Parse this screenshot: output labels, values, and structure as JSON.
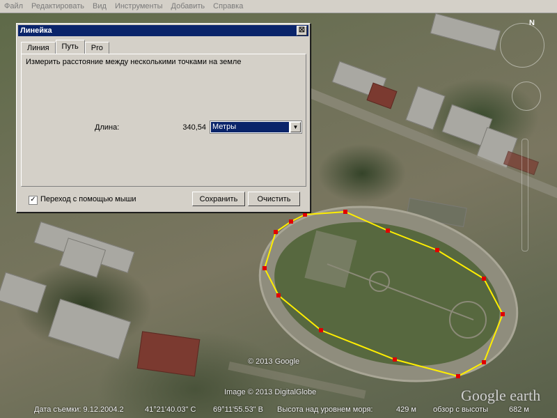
{
  "menubar": {
    "items": [
      "Файл",
      "Редактировать",
      "Вид",
      "Инструменты",
      "Добавить",
      "Справка"
    ]
  },
  "dialog": {
    "title": "Линейка",
    "close_label": "☒",
    "tabs": [
      "Линия",
      "Путь",
      "Pro"
    ],
    "active_tab": "Путь",
    "description": "Измерить расстояние между несколькими точками на земле",
    "length_label": "Длина:",
    "length_value": "340,54",
    "units_selected": "Метры",
    "mouse_nav_label": "Переход с помощью мыши",
    "mouse_nav_checked": true,
    "save_label": "Сохранить",
    "clear_label": "Очистить"
  },
  "map": {
    "compass_label": "N",
    "copyright_google": "© 2013 Google",
    "copyright_imagery": "Image © 2013 DigitalGlobe",
    "logo": "Google earth",
    "path_color": "#ffee00",
    "vertex_color": "#e00000"
  },
  "statusbar": {
    "imagery_date": "Дата съемки: 9.12.2004.2",
    "latitude": "41°21'40.03\" С",
    "longitude": "69°11'55.53\" В",
    "elevation_label": "Высота над уровнем моря:",
    "elevation_value": "429 м",
    "eye_alt_label": "обзор с высоты",
    "eye_alt_value": "682 м"
  }
}
